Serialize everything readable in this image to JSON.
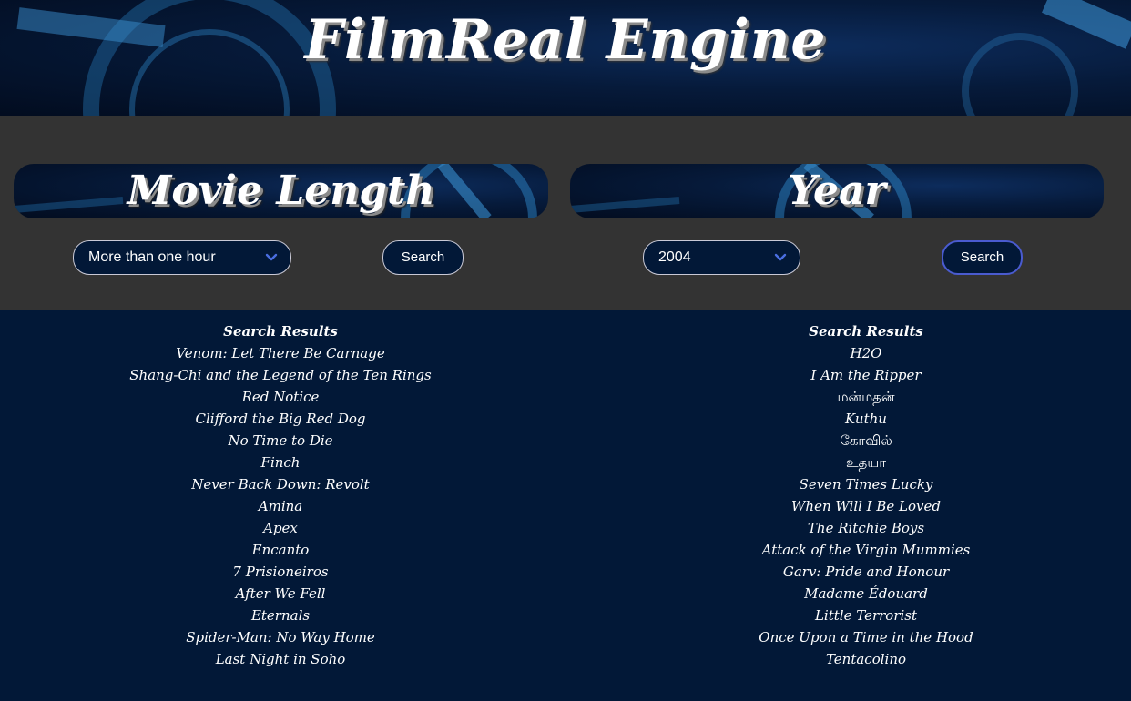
{
  "header": {
    "title": "FilmReal Engine"
  },
  "length_panel": {
    "title": "Movie Length",
    "select_value": "More than one hour",
    "search_label": "Search"
  },
  "year_panel": {
    "title": "Year",
    "select_value": "2004",
    "search_label": "Search"
  },
  "results_left": {
    "heading": "Search Results",
    "items": [
      "Venom: Let There Be Carnage",
      "Shang-Chi and the Legend of the Ten Rings",
      "Red Notice",
      "Clifford the Big Red Dog",
      "No Time to Die",
      "Finch",
      "Never Back Down: Revolt",
      "Amina",
      "Apex",
      "Encanto",
      "7 Prisioneiros",
      "After We Fell",
      "Eternals",
      "Spider-Man: No Way Home",
      "Last Night in Soho"
    ]
  },
  "results_right": {
    "heading": "Search Results",
    "items": [
      "H2O",
      "I Am the Ripper",
      "மன்மதன்",
      "Kuthu",
      "கோவில்",
      "உதயா",
      "Seven Times Lucky",
      "When Will I Be Loved",
      "The Ritchie Boys",
      "Attack of the Virgin Mummies",
      "Garv: Pride and Honour",
      "Madame Édouard",
      "Little Terrorist",
      "Once Upon a Time in the Hood",
      "Tentacolino"
    ]
  },
  "colors": {
    "page_background": "#021837",
    "controls_background": "#333333",
    "active_button_border": "#4a5bd0",
    "chevron": "#4a6ee0"
  },
  "icons": {
    "select_arrow": "chevron-down-icon",
    "banner_decoration": "film-reel-image"
  }
}
